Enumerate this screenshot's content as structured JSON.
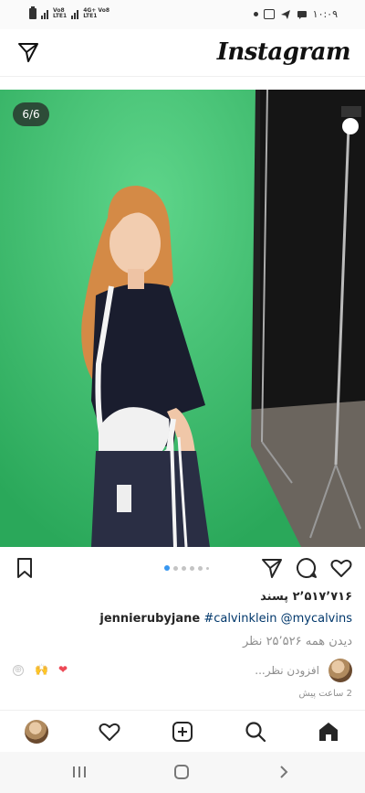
{
  "status_bar": {
    "net1": "Vo8",
    "net1_sub": "LTE1",
    "net2": "4G+ Vo8",
    "net2_sub": "LTE1",
    "time": "۱۰:۰۹"
  },
  "header": {
    "app_name": "Instagram",
    "left_icon": "direct-message-icon"
  },
  "post": {
    "slide_counter": "6/6",
    "carousel": {
      "total": 6,
      "active_index": 0
    },
    "likes": "۲٬۵۱۷٬۷۱۶ پسند",
    "caption_user": "jennierubyjane",
    "caption_text": "#calvinklein @mycalvins",
    "view_all_comments": "دیدن همه ۲۵٬۵۲۶ نظر",
    "add_comment_placeholder": "افزودن نظر...",
    "quick_emojis": [
      "❤",
      "🙌",
      "⊕"
    ],
    "time_ago": "2 ساعت پیش"
  },
  "actions": {
    "like": "heart-icon",
    "comment": "comment-icon",
    "share": "send-icon",
    "save": "bookmark-icon"
  },
  "bottom_nav": [
    "profile",
    "activity-heart",
    "new-post",
    "search",
    "home"
  ],
  "colors": {
    "green_screen": "#3fc26a",
    "accent_blue": "#3897f0",
    "heart_red": "#ed4956"
  }
}
